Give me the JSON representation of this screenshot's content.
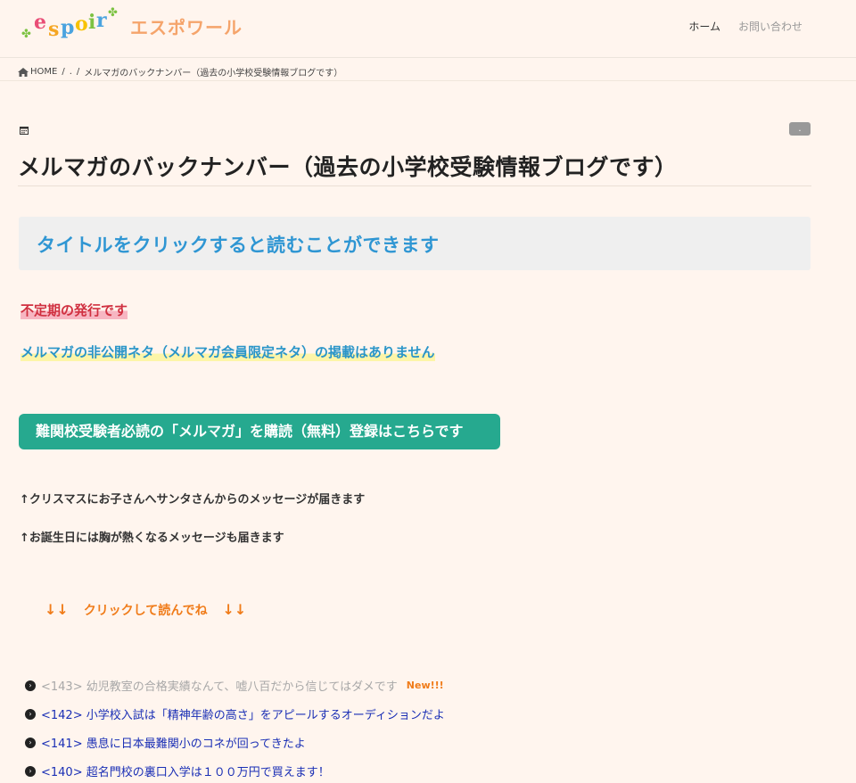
{
  "header": {
    "logo": {
      "letters": [
        "e",
        "s",
        "p",
        "o",
        "i",
        "r"
      ],
      "colors": [
        "#e94e77",
        "#f5a623",
        "#4aa3df",
        "#f8c200",
        "#7cc242",
        "#4aa3df"
      ]
    },
    "site_name": "エスポワール",
    "nav": [
      {
        "label": "ホーム"
      },
      {
        "label": "お問い合わせ"
      }
    ]
  },
  "breadcrumb": {
    "home": "HOME",
    "sep1": "/",
    "middle": ".",
    "sep2": "/",
    "current": "メルマガのバックナンバー（過去の小学校受験情報ブログです）"
  },
  "article": {
    "category_badge": ".",
    "title": "メルマガのバックナンバー（過去の小学校受験情報ブログです）",
    "lead": "タイトルをクリックすると読むことができます",
    "notice_irregular": "不定期の発行です",
    "notice_private": "メルマガの非公開ネタ（メルマガ会員限定ネタ）の掲載はありません",
    "subscribe_button": "難関校受験者必読の「メルマガ」を購読（無料）登録はこちらです",
    "message_christmas": "↑クリスマスにお子さんへサンタさんからのメッセージが届きます",
    "message_birthday": "↑お誕生日には胸が熱くなるメッセージも届きます",
    "click_hint": {
      "arrows_left": "↓↓",
      "text": "クリックして読んでね",
      "arrows_right": "↓↓"
    },
    "issues": [
      {
        "label": "<143> 幼児教室の合格実績なんて、嘘八百だから信じてはダメです",
        "badge": "New!!!",
        "visited": true
      },
      {
        "label": "<142> 小学校入試は「精神年齢の高さ」をアピールするオーディションだよ",
        "visited": false
      },
      {
        "label": "<141> 愚息に日本最難関小のコネが回ってきたよ",
        "visited": false
      },
      {
        "label": "<140> 超名門校の裏口入学は１００万円で買えます！",
        "visited": false
      }
    ]
  },
  "colors": {
    "background": "#fff5ee",
    "accent_green": "#26a98f",
    "lead_blue": "#2f96d3",
    "link_blue": "#1a2fb5",
    "orange": "#f07c1a",
    "red": "#d03040"
  }
}
